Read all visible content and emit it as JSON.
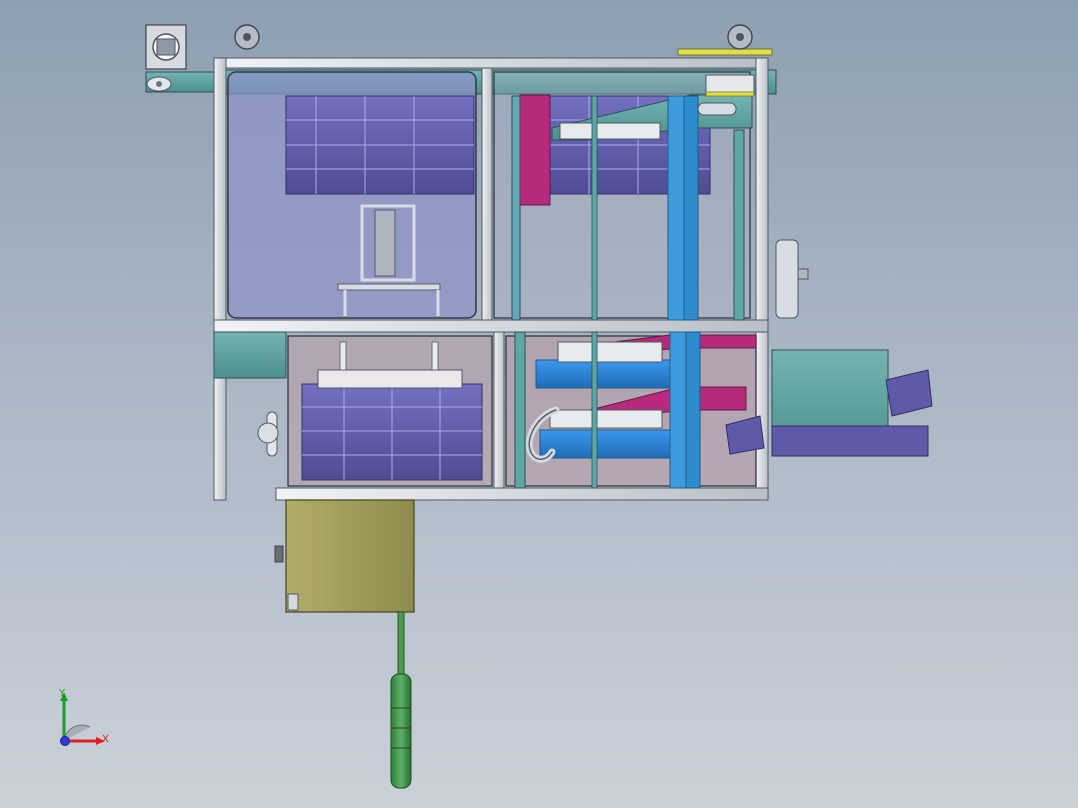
{
  "viewport": {
    "background_top": "#8d9fb1",
    "background_bottom": "#cad1d9"
  },
  "triad": {
    "x_label": "X",
    "y_label": "Y",
    "x_color": "#e02020",
    "y_color": "#1e9a2c",
    "z_color": "#2f38d9"
  },
  "colors": {
    "frame": "#d7dbe0",
    "frame_dark": "#7d8792",
    "bin_purple": "#5e5aa8",
    "bin_blue": "#2d83d8",
    "magenta": "#b7297c",
    "teal": "#5ea7a5",
    "olive": "#9c9a5a",
    "green_rod": "#4d9a4d",
    "yellow_strip": "#e2df4a",
    "panel_glass": "#8f93c8",
    "pinkish": "#b89aa4"
  },
  "icons": {
    "triad": "axis-triad-icon"
  }
}
